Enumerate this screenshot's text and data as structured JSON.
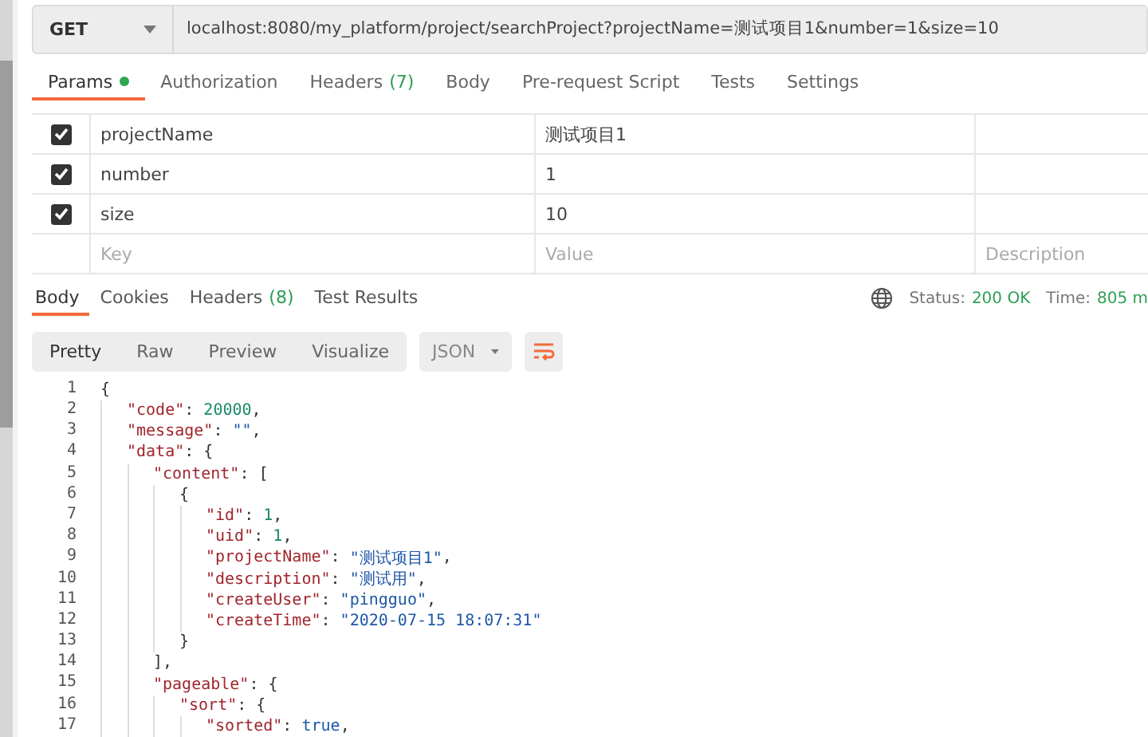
{
  "request": {
    "method": "GET",
    "url": "localhost:8080/my_platform/project/searchProject?projectName=测试项目1&number=1&size=10"
  },
  "request_tabs": [
    {
      "label": "Params",
      "dot": true,
      "selected": true
    },
    {
      "label": "Authorization",
      "dot": false,
      "selected": false
    },
    {
      "label": "Headers",
      "count": "(7)",
      "dot": false,
      "selected": false
    },
    {
      "label": "Body",
      "dot": false,
      "selected": false
    },
    {
      "label": "Pre-request Script",
      "dot": false,
      "selected": false
    },
    {
      "label": "Tests",
      "dot": false,
      "selected": false
    },
    {
      "label": "Settings",
      "dot": false,
      "selected": false
    }
  ],
  "params": {
    "rows": [
      {
        "key": "projectName",
        "value": "测试项目1",
        "checked": true
      },
      {
        "key": "number",
        "value": "1",
        "checked": true
      },
      {
        "key": "size",
        "value": "10",
        "checked": true
      }
    ],
    "new_row": {
      "key_placeholder": "Key",
      "value_placeholder": "Value",
      "description_placeholder": "Description"
    }
  },
  "response_tabs": [
    {
      "label": "Body",
      "selected": true
    },
    {
      "label": "Cookies",
      "selected": false
    },
    {
      "label": "Headers",
      "count": "(8)",
      "selected": false
    },
    {
      "label": "Test Results",
      "selected": false
    }
  ],
  "status": {
    "status_label": "Status:",
    "status_value": "200 OK",
    "time_label": "Time:",
    "time_value": "805 m"
  },
  "view_modes": [
    {
      "label": "Pretty",
      "selected": true
    },
    {
      "label": "Raw",
      "selected": false
    },
    {
      "label": "Preview",
      "selected": false
    },
    {
      "label": "Visualize",
      "selected": false
    }
  ],
  "format": "JSON",
  "code": [
    {
      "number": "1",
      "tokens": [
        {
          "kind": "punct",
          "text": "{"
        }
      ],
      "children": [
        {
          "number": "2",
          "tokens": [
            {
              "kind": "key",
              "text": "\"code\""
            },
            {
              "kind": "punct",
              "text": ": "
            },
            {
              "kind": "num",
              "text": "20000"
            },
            {
              "kind": "punct",
              "text": ","
            }
          ]
        },
        {
          "number": "3",
          "tokens": [
            {
              "kind": "key",
              "text": "\"message\""
            },
            {
              "kind": "punct",
              "text": ": "
            },
            {
              "kind": "str",
              "text": "\"\""
            },
            {
              "kind": "punct",
              "text": ","
            }
          ]
        },
        {
          "number": "4",
          "tokens": [
            {
              "kind": "key",
              "text": "\"data\""
            },
            {
              "kind": "punct",
              "text": ": {"
            }
          ],
          "children": [
            {
              "number": "5",
              "tokens": [
                {
                  "kind": "key",
                  "text": "\"content\""
                },
                {
                  "kind": "punct",
                  "text": ": ["
                }
              ],
              "children": [
                {
                  "number": "6",
                  "tokens": [
                    {
                      "kind": "punct",
                      "text": "{"
                    }
                  ],
                  "children": [
                    {
                      "number": "7",
                      "tokens": [
                        {
                          "kind": "key",
                          "text": "\"id\""
                        },
                        {
                          "kind": "punct",
                          "text": ": "
                        },
                        {
                          "kind": "num",
                          "text": "1"
                        },
                        {
                          "kind": "punct",
                          "text": ","
                        }
                      ]
                    },
                    {
                      "number": "8",
                      "tokens": [
                        {
                          "kind": "key",
                          "text": "\"uid\""
                        },
                        {
                          "kind": "punct",
                          "text": ": "
                        },
                        {
                          "kind": "num",
                          "text": "1"
                        },
                        {
                          "kind": "punct",
                          "text": ","
                        }
                      ]
                    },
                    {
                      "number": "9",
                      "tokens": [
                        {
                          "kind": "key",
                          "text": "\"projectName\""
                        },
                        {
                          "kind": "punct",
                          "text": ": "
                        },
                        {
                          "kind": "str",
                          "text": "\"测试项目1\""
                        },
                        {
                          "kind": "punct",
                          "text": ","
                        }
                      ]
                    },
                    {
                      "number": "10",
                      "tokens": [
                        {
                          "kind": "key",
                          "text": "\"description\""
                        },
                        {
                          "kind": "punct",
                          "text": ": "
                        },
                        {
                          "kind": "str",
                          "text": "\"测试用\""
                        },
                        {
                          "kind": "punct",
                          "text": ","
                        }
                      ]
                    },
                    {
                      "number": "11",
                      "tokens": [
                        {
                          "kind": "key",
                          "text": "\"createUser\""
                        },
                        {
                          "kind": "punct",
                          "text": ": "
                        },
                        {
                          "kind": "str",
                          "text": "\"pingguo\""
                        },
                        {
                          "kind": "punct",
                          "text": ","
                        }
                      ]
                    },
                    {
                      "number": "12",
                      "tokens": [
                        {
                          "kind": "key",
                          "text": "\"createTime\""
                        },
                        {
                          "kind": "punct",
                          "text": ": "
                        },
                        {
                          "kind": "str",
                          "text": "\"2020-07-15 18:07:31\""
                        }
                      ]
                    }
                  ]
                },
                {
                  "number": "13",
                  "tokens": [
                    {
                      "kind": "punct",
                      "text": "}"
                    }
                  ]
                }
              ]
            },
            {
              "number": "14",
              "tokens": [
                {
                  "kind": "punct",
                  "text": "],"
                }
              ]
            },
            {
              "number": "15",
              "tokens": [
                {
                  "kind": "key",
                  "text": "\"pageable\""
                },
                {
                  "kind": "punct",
                  "text": ": {"
                }
              ],
              "children": [
                {
                  "number": "16",
                  "tokens": [
                    {
                      "kind": "key",
                      "text": "\"sort\""
                    },
                    {
                      "kind": "punct",
                      "text": ": {"
                    }
                  ],
                  "children": [
                    {
                      "number": "17",
                      "tokens": [
                        {
                          "kind": "key",
                          "text": "\"sorted\""
                        },
                        {
                          "kind": "punct",
                          "text": ": "
                        },
                        {
                          "kind": "bool",
                          "text": "true"
                        },
                        {
                          "kind": "punct",
                          "text": ","
                        }
                      ]
                    }
                  ]
                }
              ]
            }
          ]
        }
      ]
    }
  ]
}
